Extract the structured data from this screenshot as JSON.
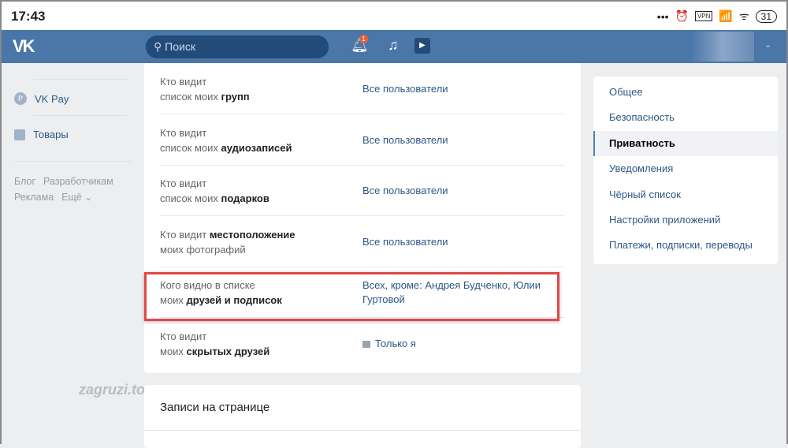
{
  "status_bar": {
    "time": "17:43",
    "dots": "•••",
    "alarm": "⏰",
    "vpn": "VPN",
    "signal": "📶",
    "wifi": "ᯤ",
    "battery": "31"
  },
  "header": {
    "logo": "VK",
    "search_placeholder": "Поиск",
    "notification_count": "1"
  },
  "sidebar": {
    "items": [
      {
        "label": "VK Pay",
        "icon": "P"
      },
      {
        "label": "Товары"
      }
    ],
    "footer": [
      "Блог",
      "Разработчикам",
      "Реклама",
      "Ещё ⌄"
    ]
  },
  "privacy_rows": [
    {
      "l1": "Кто видит",
      "l1b": "",
      "l2": "список моих ",
      "l2b": "групп",
      "value": "Все пользователи"
    },
    {
      "l1": "Кто видит",
      "l1b": "",
      "l2": "список моих ",
      "l2b": "аудиозаписей",
      "value": "Все пользователи"
    },
    {
      "l1": "Кто видит",
      "l1b": "",
      "l2": "список моих ",
      "l2b": "подарков",
      "value": "Все пользователи"
    },
    {
      "l1": "Кто видит ",
      "l1b": "местоположение",
      "l2": "моих фотографий",
      "l2b": "",
      "value": "Все пользователи"
    },
    {
      "l1": "Кого видно в списке",
      "l1b": "",
      "l2": "моих ",
      "l2b": "друзей и подписок",
      "value": "Всех, кроме: Андрея Будченко, Юлии Гуртовой"
    },
    {
      "l1": "Кто видит",
      "l1b": "",
      "l2": "моих ",
      "l2b": "скрытых друзей",
      "value": "Только я"
    }
  ],
  "section2_title": "Записи на странице",
  "watermark": "zagruzi.top",
  "settings_menu": [
    "Общее",
    "Безопасность",
    "Приватность",
    "Уведомления",
    "Чёрный список",
    "Настройки приложений",
    "Платежи, подписки, переводы"
  ],
  "active_menu": "Приватность",
  "colors": {
    "header": "#4a76a8",
    "link": "#2a5885",
    "highlight": "#e04848"
  }
}
